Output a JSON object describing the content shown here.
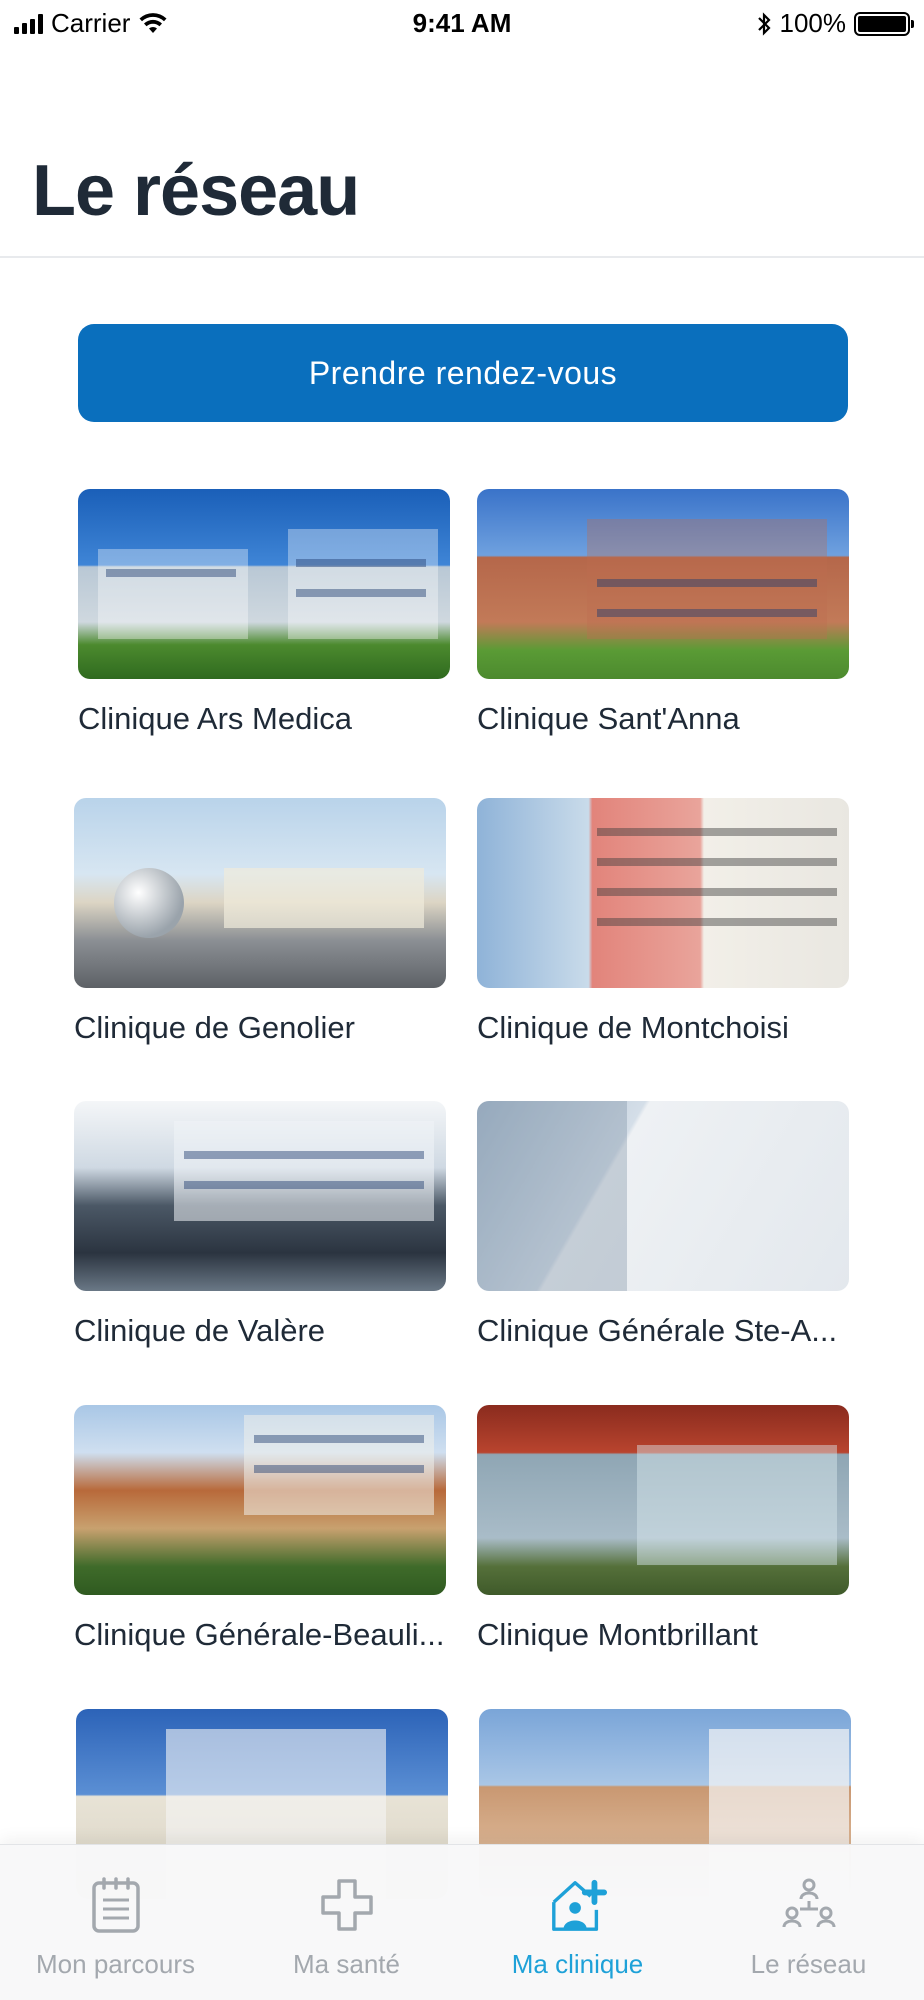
{
  "status_bar": {
    "carrier": "Carrier",
    "time": "9:41 AM",
    "battery": "100%",
    "battery_level": 1.0
  },
  "header": {
    "title": "Le réseau"
  },
  "cta": {
    "label": "Prendre rendez-vous"
  },
  "clinics": [
    {
      "name": "Clinique Ars Medica"
    },
    {
      "name": "Clinique Sant'Anna"
    },
    {
      "name": "Clinique de Genolier"
    },
    {
      "name": "Clinique de Montchoisi"
    },
    {
      "name": "Clinique de Valère"
    },
    {
      "name": "Clinique Générale Ste-A..."
    },
    {
      "name": "Clinique Générale-Beauli..."
    },
    {
      "name": "Clinique Montbrillant"
    },
    {
      "name": ""
    },
    {
      "name": ""
    }
  ],
  "tab_bar": {
    "tabs": [
      {
        "label": "Mon parcours",
        "icon": "clipboard-icon"
      },
      {
        "label": "Ma santé",
        "icon": "medical-cross-icon"
      },
      {
        "label": "Ma clinique",
        "icon": "clinic-house-icon",
        "active": true
      },
      {
        "label": "Le réseau",
        "icon": "network-people-icon"
      }
    ],
    "active_color": "#1ea1d8",
    "inactive_color": "#a3a8ae"
  },
  "colors": {
    "accent": "#0a6fbd",
    "title": "#1f2a37"
  }
}
